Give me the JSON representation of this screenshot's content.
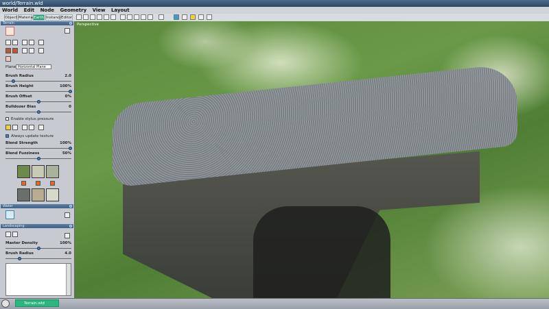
{
  "window": {
    "title": "world/Terrain.wld"
  },
  "menu": [
    "World",
    "Edit",
    "Node",
    "Geometry",
    "View",
    "Layout"
  ],
  "tabs": [
    {
      "label": "Object",
      "active": false
    },
    {
      "label": "Material",
      "active": false
    },
    {
      "label": "Earth",
      "active": true
    },
    {
      "label": "Instance",
      "active": false
    },
    {
      "label": "Editor",
      "active": false
    }
  ],
  "terrain": {
    "section_title": "Terrain",
    "plane_label": "Plane",
    "plane_value": "Horizontal Plane",
    "brush_radius": {
      "label": "Brush Radius",
      "value": "2.0",
      "fraction": 0.1
    },
    "brush_height": {
      "label": "Brush Height",
      "value": "100%",
      "fraction": 1.0
    },
    "brush_offset": {
      "label": "Brush Offset",
      "value": "0%",
      "fraction": 0.5
    },
    "bulldozer_bias": {
      "label": "Bulldozer Bias",
      "value": "0",
      "fraction": 0.5
    },
    "stylus": {
      "label": "Enable stylus pressure",
      "checked": false
    },
    "always_update": {
      "label": "Always update texture",
      "checked": true
    },
    "blend_strength": {
      "label": "Blend Strength",
      "value": "100%",
      "fraction": 1.0
    },
    "blend_fuzziness": {
      "label": "Blend Fuzziness",
      "value": "50%",
      "fraction": 0.5
    }
  },
  "water": {
    "section_title": "Water"
  },
  "landscaping": {
    "section_title": "Landscaping",
    "master_density": {
      "label": "Master Density",
      "value": "100%",
      "fraction": 0.5
    },
    "brush_radius": {
      "label": "Brush Radius",
      "value": "4.0",
      "fraction": 0.2
    }
  },
  "viewport": {
    "label": "Perspective"
  },
  "taskbar": {
    "item": "Terrain.wld"
  },
  "colors": {
    "accent": "#2aa47a",
    "header": "#4a6d95"
  }
}
